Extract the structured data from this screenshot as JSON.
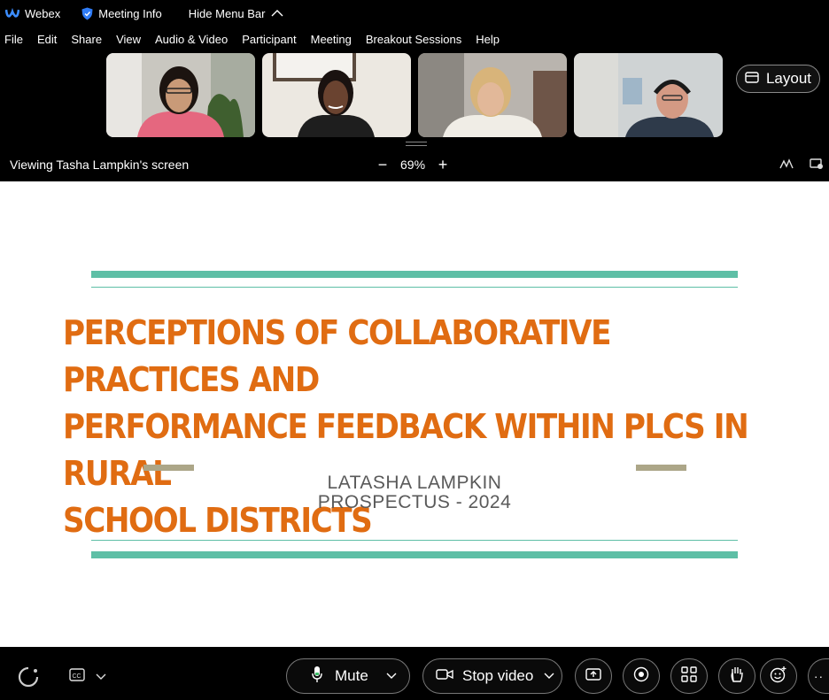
{
  "titlebar": {
    "app_name": "Webex",
    "meeting_info": "Meeting Info",
    "hide_menu": "Hide Menu Bar"
  },
  "menu": [
    "File",
    "Edit",
    "Share",
    "View",
    "Audio & Video",
    "Participant",
    "Meeting",
    "Breakout Sessions",
    "Help"
  ],
  "layout_label": "Layout",
  "viewing_label": "Viewing Tasha Lampkin's screen",
  "zoom_level": "69%",
  "slide": {
    "title_line1": "PERCEPTIONS OF COLLABORATIVE PRACTICES AND",
    "title_line2": "PERFORMANCE FEEDBACK WITHIN PLCS IN RURAL",
    "title_line3": "SCHOOL DISTRICTS",
    "subtitle_line1": "LATASHA LAMPKIN",
    "subtitle_line2": "PROSPECTUS - 2024",
    "colors": {
      "title": "#e06c12",
      "bars": "#5ebfa6",
      "accent": "#aca688",
      "subtitle": "#5a5a5a"
    }
  },
  "toolbar": {
    "mute_label": "Mute",
    "stop_video_label": "Stop video"
  },
  "icons": [
    "webex-logo-icon",
    "shield-icon",
    "chevron-up-icon",
    "layout-icon",
    "annotate-icon",
    "screen-control-icon",
    "webex-ai-icon",
    "closed-caption-icon",
    "chevron-down-icon",
    "microphone-icon",
    "video-camera-icon",
    "share-icon",
    "record-icon",
    "apps-icon",
    "raise-hand-icon",
    "reactions-icon",
    "more-icon"
  ]
}
